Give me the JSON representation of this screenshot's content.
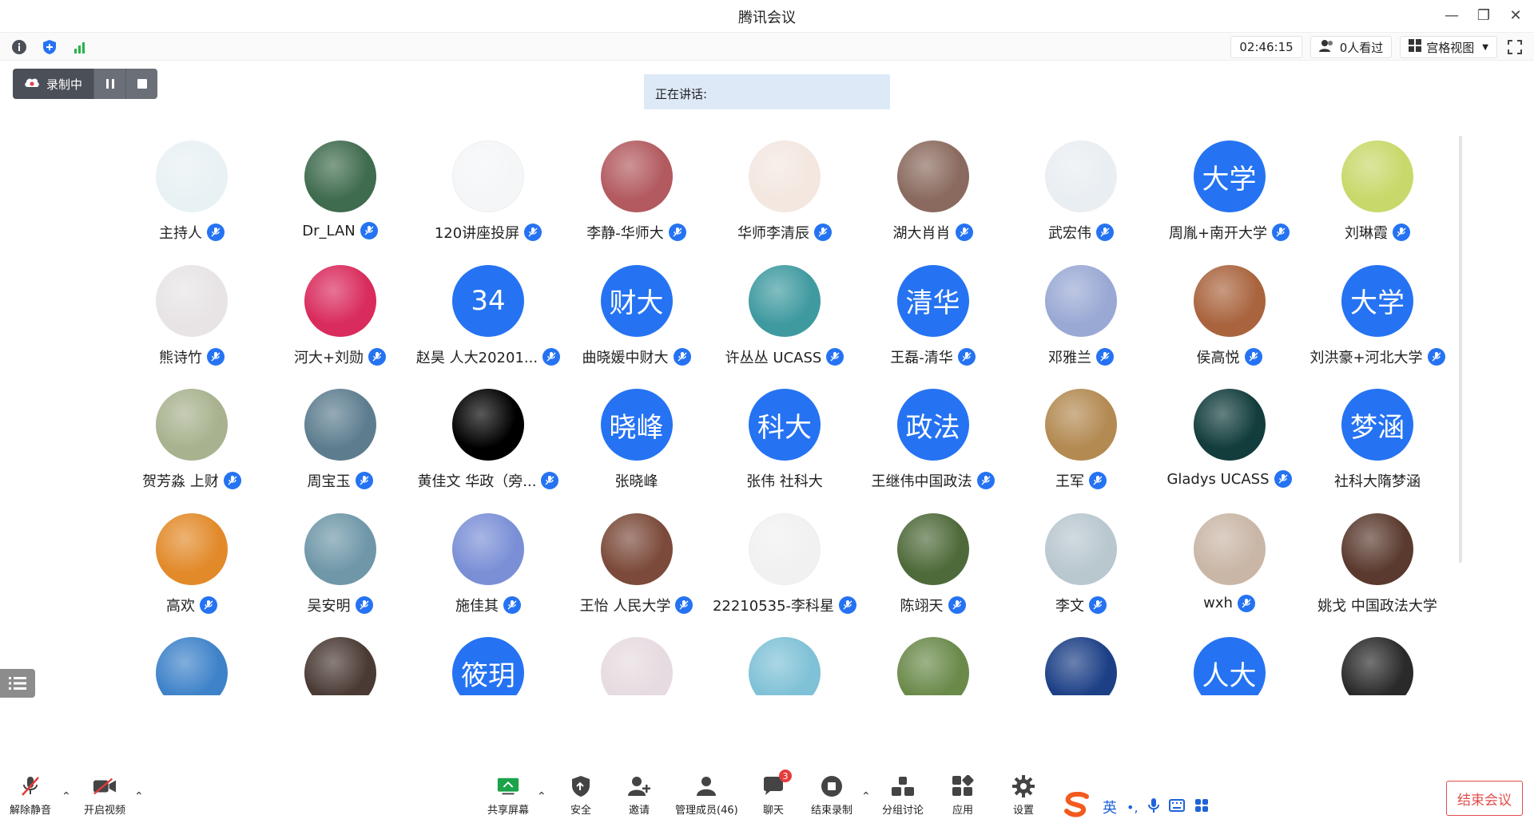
{
  "window": {
    "title": "腾讯会议"
  },
  "topbar": {
    "timer": "02:46:15",
    "viewers": "0人看过",
    "view_mode": "宫格视图"
  },
  "recording": {
    "label": "录制中"
  },
  "speaking": {
    "label": "正在讲话:"
  },
  "participants": [
    {
      "name": "主持人",
      "avatar": "photo",
      "color": "#e8f1f4"
    },
    {
      "name": "Dr_LAN",
      "avatar": "photo",
      "color": "#3f6b4e"
    },
    {
      "name": "120讲座投屏",
      "avatar": "photo",
      "color": "#f4f6f8"
    },
    {
      "name": "李静-华师大",
      "avatar": "photo",
      "color": "#b25a5f"
    },
    {
      "name": "华师李清辰",
      "avatar": "photo",
      "color": "#f3e7e0"
    },
    {
      "name": "湖大肖肖",
      "avatar": "photo",
      "color": "#8a6a5e"
    },
    {
      "name": "武宏伟",
      "avatar": "photo",
      "color": "#e9eef2"
    },
    {
      "name": "周胤+南开大学",
      "avatar": "text",
      "text": "大学"
    },
    {
      "name": "刘琳霞",
      "avatar": "photo",
      "color": "#c9d86a"
    },
    {
      "name": "熊诗竹",
      "avatar": "photo",
      "color": "#e8e4e6"
    },
    {
      "name": "河大+刘勋",
      "avatar": "photo",
      "color": "#d92b5c"
    },
    {
      "name": "赵昊 人大20201...",
      "avatar": "text",
      "text": "34"
    },
    {
      "name": "曲晓媛中财大",
      "avatar": "text",
      "text": "财大"
    },
    {
      "name": "许丛丛 UCASS",
      "avatar": "photo",
      "color": "#3f9aa0"
    },
    {
      "name": "王磊-清华",
      "avatar": "text",
      "text": "清华"
    },
    {
      "name": "邓雅兰",
      "avatar": "photo",
      "color": "#9aa9d4"
    },
    {
      "name": "侯高悦",
      "avatar": "photo",
      "color": "#a9643e"
    },
    {
      "name": "刘洪豪+河北大学",
      "avatar": "text",
      "text": "大学"
    },
    {
      "name": "贺芳淼 上财",
      "avatar": "photo",
      "color": "#a8b28e"
    },
    {
      "name": "周宝玉",
      "avatar": "photo",
      "color": "#5d7d8f"
    },
    {
      "name": "黄佳文 华政（旁...",
      "avatar": "photo",
      "color": "#000000"
    },
    {
      "name": "张晓峰",
      "avatar": "text",
      "text": "晓峰",
      "nomic": true
    },
    {
      "name": "张伟 社科大",
      "avatar": "text",
      "text": "科大",
      "nomic": true
    },
    {
      "name": "王继伟中国政法",
      "avatar": "text",
      "text": "政法"
    },
    {
      "name": "王军",
      "avatar": "photo",
      "color": "#b38a52"
    },
    {
      "name": "Gladys UCASS",
      "avatar": "photo",
      "color": "#123d3c"
    },
    {
      "name": "社科大隋梦涵",
      "avatar": "text",
      "text": "梦涵",
      "nomic": true
    },
    {
      "name": "高欢",
      "avatar": "photo",
      "color": "#e28a2a"
    },
    {
      "name": "吴安明",
      "avatar": "photo",
      "color": "#6f97a8"
    },
    {
      "name": "施佳其",
      "avatar": "photo",
      "color": "#7a8fd6"
    },
    {
      "name": "王怡 人民大学",
      "avatar": "photo",
      "color": "#7b4a3a"
    },
    {
      "name": "22210535-李科星",
      "avatar": "photo",
      "color": "#f1f1f1"
    },
    {
      "name": "陈翊天",
      "avatar": "photo",
      "color": "#4f6a3a"
    },
    {
      "name": "李文",
      "avatar": "photo",
      "color": "#b9c7cf"
    },
    {
      "name": "wxh",
      "avatar": "photo",
      "color": "#c9b6a6"
    },
    {
      "name": "姚戈 中国政法大学",
      "avatar": "photo",
      "color": "#5a3a2e",
      "nomic": true
    },
    {
      "name": "",
      "avatar": "photo",
      "color": "#3e82c9"
    },
    {
      "name": "",
      "avatar": "photo",
      "color": "#4a3a34"
    },
    {
      "name": "",
      "avatar": "text",
      "text": "筱玥"
    },
    {
      "name": "",
      "avatar": "photo",
      "color": "#e6dbe0"
    },
    {
      "name": "",
      "avatar": "photo",
      "color": "#7fc1d6"
    },
    {
      "name": "",
      "avatar": "photo",
      "color": "#6a8a4a"
    },
    {
      "name": "",
      "avatar": "photo",
      "color": "#1c3f86"
    },
    {
      "name": "",
      "avatar": "text",
      "text": "人大"
    },
    {
      "name": "",
      "avatar": "photo",
      "color": "#2a2a2a"
    }
  ],
  "bottombar": {
    "unmute": "解除静音",
    "start_video": "开启视频",
    "share_screen": "共享屏幕",
    "security": "安全",
    "invite": "邀请",
    "manage_members": "管理成员(46)",
    "chat": "聊天",
    "chat_badge": "3",
    "end_recording": "结束录制",
    "breakout": "分组讨论",
    "apps": "应用",
    "settings": "设置",
    "end_meeting": "结束会议"
  },
  "ime": {
    "lang": "英",
    "punct": "•,"
  }
}
